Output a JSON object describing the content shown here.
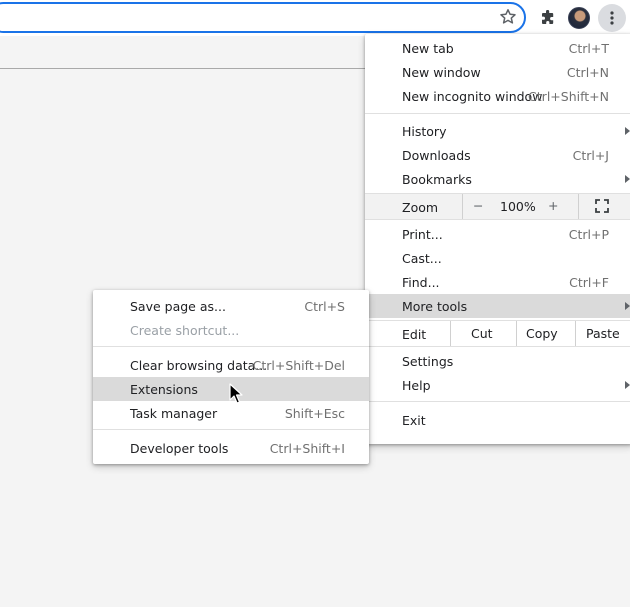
{
  "toolbar": {
    "icons": [
      "bookmark-star-icon",
      "extensions-puzzle-icon",
      "profile-avatar",
      "kebab-menu-icon"
    ]
  },
  "main_menu": {
    "new_tab": {
      "label": "New tab",
      "shortcut": "Ctrl+T"
    },
    "new_window": {
      "label": "New window",
      "shortcut": "Ctrl+N"
    },
    "new_incognito": {
      "label": "New incognito window",
      "shortcut": "Ctrl+Shift+N"
    },
    "history": {
      "label": "History"
    },
    "downloads": {
      "label": "Downloads",
      "shortcut": "Ctrl+J"
    },
    "bookmarks": {
      "label": "Bookmarks"
    },
    "zoom": {
      "label": "Zoom",
      "minus": "−",
      "value": "100%",
      "plus": "+"
    },
    "print": {
      "label": "Print...",
      "shortcut": "Ctrl+P"
    },
    "cast": {
      "label": "Cast..."
    },
    "find": {
      "label": "Find...",
      "shortcut": "Ctrl+F"
    },
    "more_tools": {
      "label": "More tools"
    },
    "edit": {
      "label": "Edit",
      "cut": "Cut",
      "copy": "Copy",
      "paste": "Paste"
    },
    "settings": {
      "label": "Settings"
    },
    "help": {
      "label": "Help"
    },
    "exit": {
      "label": "Exit"
    }
  },
  "sub_menu": {
    "save_page": {
      "label": "Save page as...",
      "shortcut": "Ctrl+S"
    },
    "create_shortcut": {
      "label": "Create shortcut..."
    },
    "clear_data": {
      "label": "Clear browsing data...",
      "shortcut": "Ctrl+Shift+Del"
    },
    "extensions": {
      "label": "Extensions"
    },
    "task_manager": {
      "label": "Task manager",
      "shortcut": "Shift+Esc"
    },
    "developer_tools": {
      "label": "Developer tools",
      "shortcut": "Ctrl+Shift+I"
    }
  },
  "colors": {
    "accent": "#1a73e8",
    "highlight": "#dadada",
    "page_background": "#f4f4f4"
  }
}
